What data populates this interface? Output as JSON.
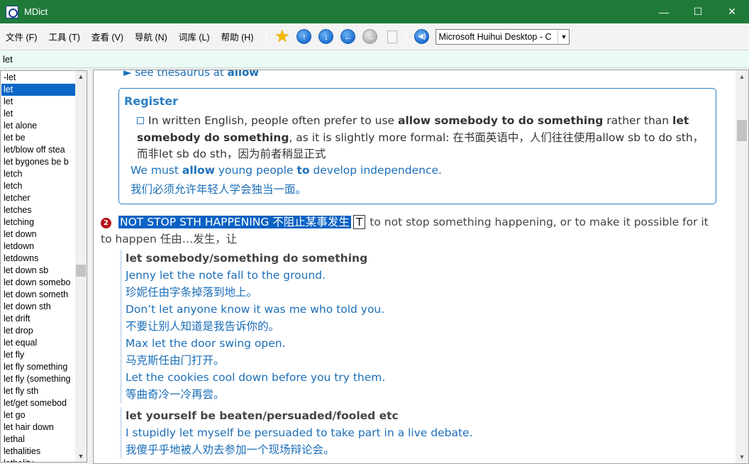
{
  "window": {
    "title": "MDict",
    "controls": [
      "—",
      "☐",
      "✕"
    ]
  },
  "menu": [
    "文件 (F)",
    "工具 (T)",
    "查看 (V)",
    "导航 (N)",
    "词库 (L)",
    "帮助 (H)"
  ],
  "toolbar": {
    "font_select_value": "Microsoft Huihui Desktop - C"
  },
  "search": {
    "value": "let"
  },
  "wordlist": [
    "-let",
    "let",
    "let",
    "let",
    "let alone",
    "let be",
    "let/blow off stea",
    "let bygones be b",
    "letch",
    "letch",
    "letcher",
    "letches",
    "letching",
    "let down",
    "letdown",
    "letdowns",
    "let down sb",
    "let down somebo",
    "let down someth",
    "let down sth",
    "let drift",
    "let drop",
    "let equal",
    "let fly",
    "let fly something",
    "let fly (something",
    "let fly sth",
    "let/get somebod",
    "let go",
    "let hair down",
    "lethal",
    "lethalities",
    "lethality"
  ],
  "wordlist_selected_index": 1,
  "entry": {
    "thesaurus_prefix": "► see thesaurus at ",
    "thesaurus_word": "allow",
    "register": {
      "title": "Register",
      "text_1": "In written English, people often prefer to use ",
      "text_b1": "allow somebody to do something",
      "text_2": " rather than ",
      "text_b2": "let somebody do something",
      "text_3": ", as it is slightly more formal: 在书面英语中，人们往往使用allow sb to do sth，而非let sb do sth，因为前者稍显正式",
      "example_1": "We must ",
      "example_b1": "allow",
      "example_2": " young people ",
      "example_b2": "to",
      "example_3": " develop independence.",
      "example_cn": "我们必须允许年轻人学会独当一面。"
    },
    "sense": {
      "number": "2",
      "heading": "NOT STOP STH HAPPENING 不阻止某事发生",
      "tag": "T",
      "definition": "to not stop something happening, or to make it possible for it to happen 任由…发生，让"
    },
    "example_groups": [
      {
        "pattern": "let somebody/something do something",
        "examples": [
          {
            "en": "Jenny let the note fall to the ground.",
            "cn": "珍妮任由字条掉落到地上。"
          },
          {
            "en": "Don’t let anyone know it was me who told you.",
            "cn": "不要让别人知道是我告诉你的。"
          },
          {
            "en": "Max let the door swing open.",
            "cn": "马克斯任由门打开。"
          },
          {
            "en": "Let the cookies cool down before you try them.",
            "cn": "等曲奇冷一冷再尝。"
          }
        ]
      },
      {
        "pattern": "let yourself be beaten/persuaded/fooled etc",
        "examples": [
          {
            "en": "I stupidly let myself be persuaded to take part in a live debate.",
            "cn": "我傻乎乎地被人劝去参加一个现场辩论会。"
          }
        ]
      }
    ]
  },
  "colors": {
    "titlebar": "#1f7a3a",
    "selection": "#0b67c6",
    "link_blue": "#1b6fb8",
    "sense_badge": "#b3141b"
  },
  "icons": [
    "favorites-star-icon",
    "up-arrow-icon",
    "down-arrow-icon",
    "back-arrow-icon",
    "forward-arrow-icon",
    "clipboard-icon",
    "speaker-icon"
  ]
}
